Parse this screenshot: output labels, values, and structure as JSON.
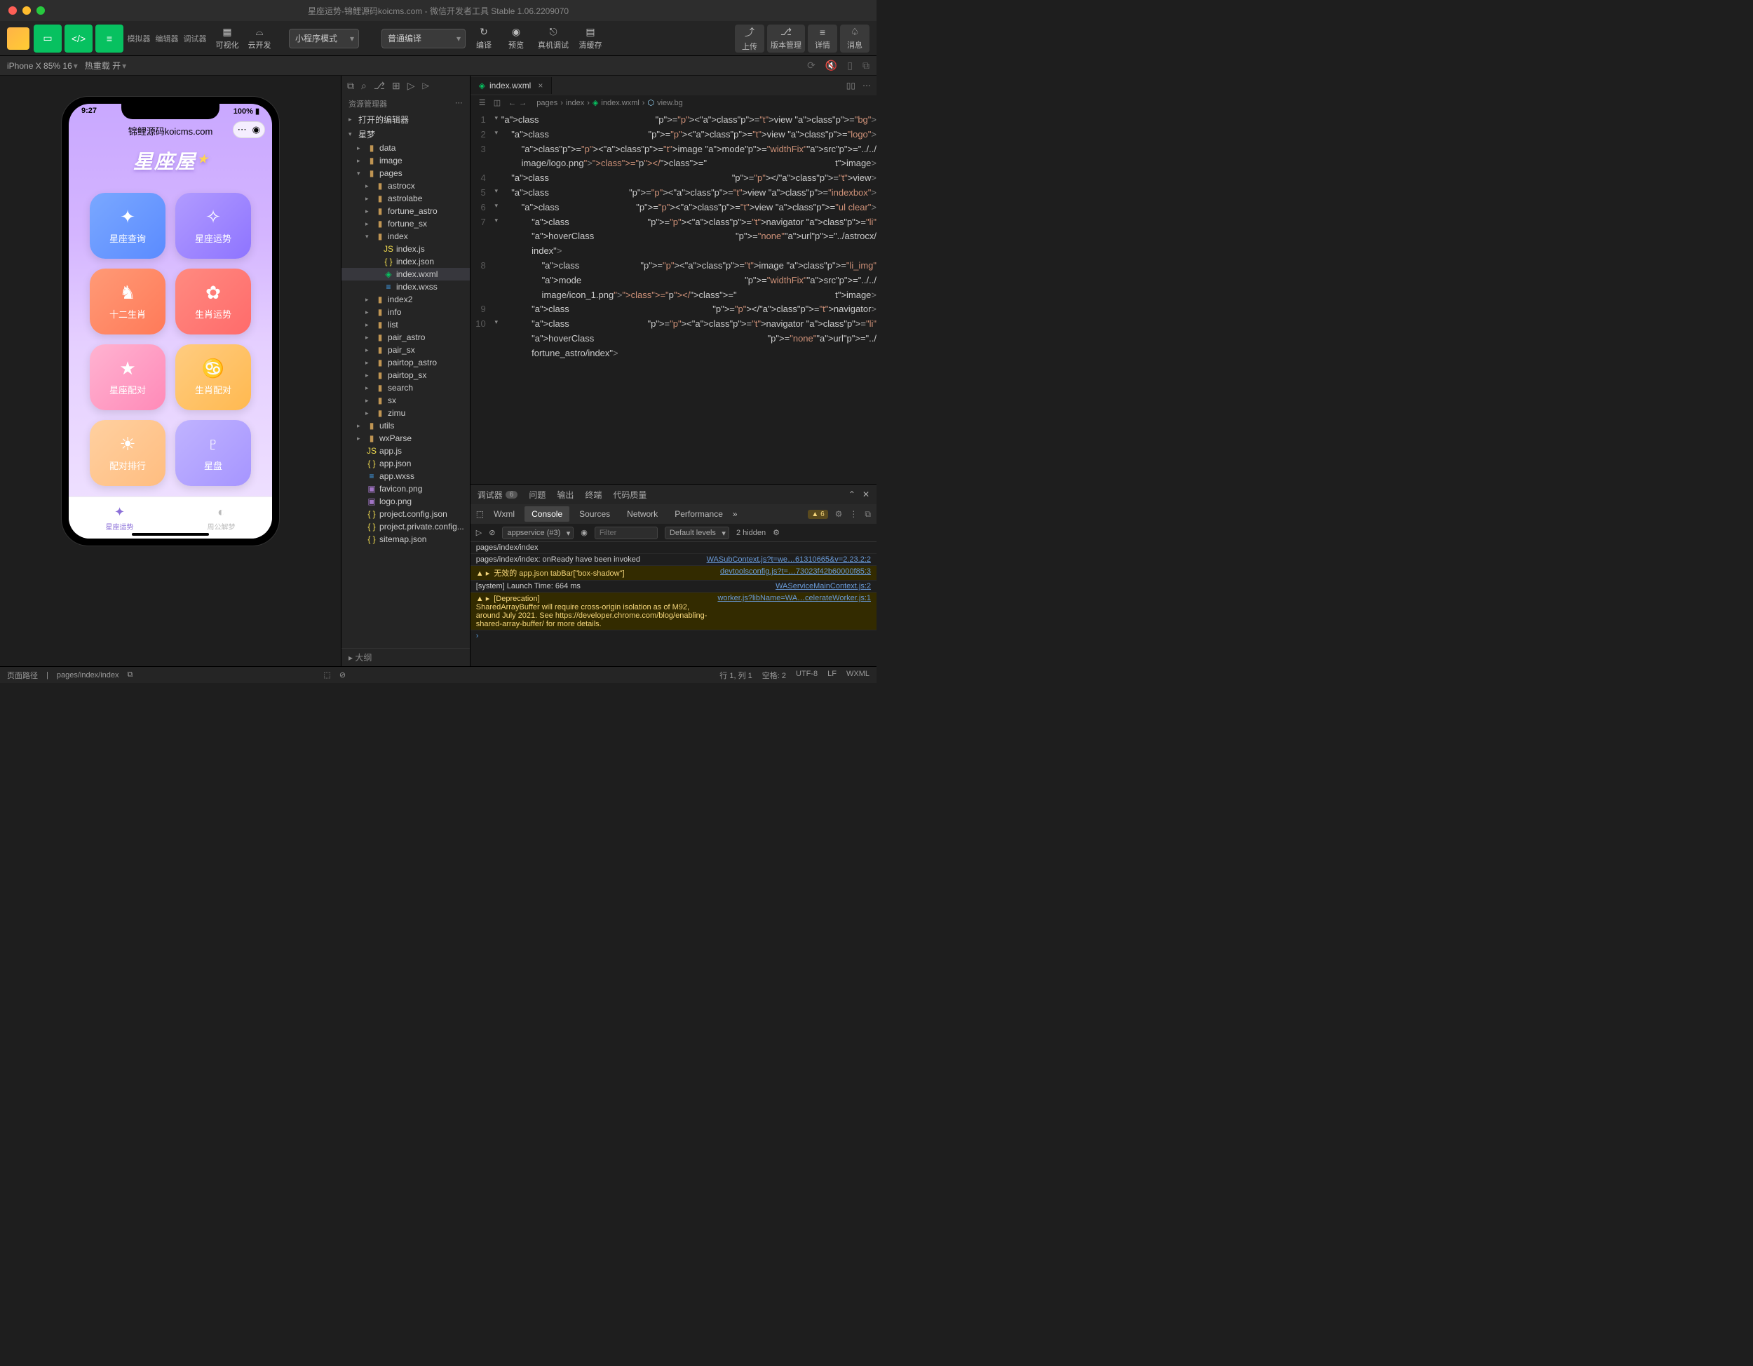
{
  "titlebar": {
    "title": "星座运势-锦鲤源码koicms.com - 微信开发者工具 Stable 1.06.2209070"
  },
  "toolbar": {
    "simulator": "模拟器",
    "editor": "编辑器",
    "debugger": "调试器",
    "visual": "可视化",
    "cloud": "云开发",
    "mode": "小程序模式",
    "compile": "普通编译",
    "compileBtn": "编译",
    "preview": "预览",
    "realDebug": "真机调试",
    "clearCache": "清缓存",
    "upload": "上传",
    "version": "版本管理",
    "details": "详情",
    "message": "消息"
  },
  "simbar": {
    "device": "iPhone X 85% 16",
    "reload": "热重载 开"
  },
  "phone": {
    "time": "9:27",
    "battery": "100%",
    "title": "锦鲤源码koicms.com",
    "logo": "星座屋",
    "tiles": [
      {
        "label": "星座查询",
        "cls": "t1",
        "icon": "✦"
      },
      {
        "label": "星座运势",
        "cls": "t2",
        "icon": "✧"
      },
      {
        "label": "十二生肖",
        "cls": "t3",
        "icon": "♞"
      },
      {
        "label": "生肖运势",
        "cls": "t4",
        "icon": "✿"
      },
      {
        "label": "星座配对",
        "cls": "t5",
        "icon": "★"
      },
      {
        "label": "生肖配对",
        "cls": "t6",
        "icon": "♋"
      },
      {
        "label": "配对排行",
        "cls": "t7",
        "icon": "☀"
      },
      {
        "label": "星盘",
        "cls": "t8",
        "icon": "♇"
      }
    ],
    "tab1": "星座运势",
    "tab2": "周公解梦"
  },
  "explorer": {
    "title": "资源管理器",
    "openEditors": "打开的编辑器",
    "project": "星梦",
    "outline": "大纲",
    "items": [
      {
        "label": "data",
        "kind": "folder",
        "pad": "pad1",
        "chev": "▸"
      },
      {
        "label": "image",
        "kind": "folder",
        "pad": "pad1",
        "chev": "▸",
        "ic": "🖼"
      },
      {
        "label": "pages",
        "kind": "folder",
        "pad": "pad1",
        "chev": "▾",
        "ic": "📁"
      },
      {
        "label": "astrocx",
        "kind": "folder",
        "pad": "pad2",
        "chev": "▸"
      },
      {
        "label": "astrolabe",
        "kind": "folder",
        "pad": "pad2",
        "chev": "▸"
      },
      {
        "label": "fortune_astro",
        "kind": "folder",
        "pad": "pad2",
        "chev": "▸"
      },
      {
        "label": "fortune_sx",
        "kind": "folder",
        "pad": "pad2",
        "chev": "▸"
      },
      {
        "label": "index",
        "kind": "folder",
        "pad": "pad2",
        "chev": "▾",
        "ic": "📂"
      },
      {
        "label": "index.js",
        "kind": "js",
        "pad": "pad3"
      },
      {
        "label": "index.json",
        "kind": "json",
        "pad": "pad3"
      },
      {
        "label": "index.wxml",
        "kind": "wxml",
        "pad": "pad3",
        "sel": true
      },
      {
        "label": "index.wxss",
        "kind": "wxss",
        "pad": "pad3"
      },
      {
        "label": "index2",
        "kind": "folder",
        "pad": "pad2",
        "chev": "▸"
      },
      {
        "label": "info",
        "kind": "folder",
        "pad": "pad2",
        "chev": "▸"
      },
      {
        "label": "list",
        "kind": "folder",
        "pad": "pad2",
        "chev": "▸"
      },
      {
        "label": "pair_astro",
        "kind": "folder",
        "pad": "pad2",
        "chev": "▸"
      },
      {
        "label": "pair_sx",
        "kind": "folder",
        "pad": "pad2",
        "chev": "▸"
      },
      {
        "label": "pairtop_astro",
        "kind": "folder",
        "pad": "pad2",
        "chev": "▸"
      },
      {
        "label": "pairtop_sx",
        "kind": "folder",
        "pad": "pad2",
        "chev": "▸"
      },
      {
        "label": "search",
        "kind": "folder",
        "pad": "pad2",
        "chev": "▸"
      },
      {
        "label": "sx",
        "kind": "folder",
        "pad": "pad2",
        "chev": "▸"
      },
      {
        "label": "zimu",
        "kind": "folder",
        "pad": "pad2",
        "chev": "▸"
      },
      {
        "label": "utils",
        "kind": "folder",
        "pad": "pad1",
        "chev": "▸",
        "ic": "📁"
      },
      {
        "label": "wxParse",
        "kind": "folder",
        "pad": "pad1",
        "chev": "▸"
      },
      {
        "label": "app.js",
        "kind": "js",
        "pad": "pad1"
      },
      {
        "label": "app.json",
        "kind": "json",
        "pad": "pad1"
      },
      {
        "label": "app.wxss",
        "kind": "wxss",
        "pad": "pad1"
      },
      {
        "label": "favicon.png",
        "kind": "png",
        "pad": "pad1"
      },
      {
        "label": "logo.png",
        "kind": "png",
        "pad": "pad1"
      },
      {
        "label": "project.config.json",
        "kind": "json",
        "pad": "pad1"
      },
      {
        "label": "project.private.config...",
        "kind": "json",
        "pad": "pad1"
      },
      {
        "label": "sitemap.json",
        "kind": "json",
        "pad": "pad1"
      }
    ]
  },
  "editor": {
    "tab": "index.wxml",
    "crumbs": [
      "pages",
      "index",
      "index.wxml",
      "view.bg"
    ]
  },
  "devtools": {
    "tabs": {
      "debugger": "调试器",
      "badge": "6",
      "problems": "问题",
      "output": "输出",
      "terminal": "终端",
      "quality": "代码质量"
    },
    "subtabs": [
      "Wxml",
      "Console",
      "Sources",
      "Network",
      "Performance"
    ],
    "warnCount": "6",
    "context": "appservice (#3)",
    "filterPlaceholder": "Filter",
    "levels": "Default levels",
    "hidden": "2 hidden",
    "lines": [
      {
        "type": "log",
        "msg": "pages/index/index",
        "src": ""
      },
      {
        "type": "log",
        "msg": "pages/index/index: onReady have been invoked",
        "src": "WASubContext.js?t=we…61310665&v=2.23.2:2"
      },
      {
        "type": "warn",
        "msg": "无效的 app.json tabBar[\"box-shadow\"]",
        "src": "devtoolsconfig.js?t=…73023f42b60000f85:3"
      },
      {
        "type": "log",
        "msg": "[system] Launch Time: 664 ms",
        "src": "WAServiceMainContext.js:2"
      },
      {
        "type": "warn",
        "msg": "[Deprecation]\nSharedArrayBuffer will require cross-origin isolation as of M92, around July 2021. See https://developer.chrome.com/blog/enabling-shared-array-buffer/ for more details.",
        "src": "worker.js?libName=WA…celerateWorker.js:1"
      }
    ]
  },
  "statusbar": {
    "pathLabel": "页面路径",
    "path": "pages/index/index",
    "pos": "行 1, 列 1",
    "spaces": "空格: 2",
    "enc": "UTF-8",
    "eol": "LF",
    "lang": "WXML"
  }
}
